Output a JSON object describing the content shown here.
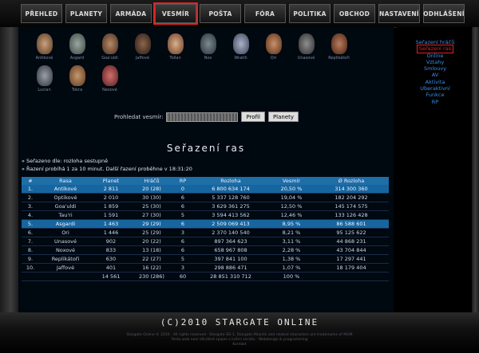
{
  "nav": {
    "tabs": [
      "PŘEHLED",
      "PLANETY",
      "ARMÁDA",
      "VESMÍR",
      "POŠTA",
      "FÓRA",
      "POLITIKA",
      "OBCHOD",
      "NASTAVENÍ",
      "ODHLÁŠENÍ"
    ],
    "active": "VESMÍR"
  },
  "avatars": [
    "Antikové",
    "Asgard",
    "Goa'uldi",
    "Jaffové",
    "Tollan",
    "Nox",
    "Wraith",
    "Ori",
    "Unasové",
    "Replikátoři",
    "Lucian",
    "Tokra",
    "Nexové"
  ],
  "search": {
    "label": "Prohledat vesmír:",
    "profile_button": "Profil",
    "planets_button": "Planety"
  },
  "page_title": "Seřazení ras",
  "sort_info": "» Seřazeno dle: rozloha sestupně",
  "update_info": "» Řazení probíhá 1 za 10 minut. Další řazení proběhne v 18:31:20",
  "table": {
    "headers": [
      "#",
      "Rasa",
      "Planet",
      "Hráčů",
      "RP",
      "Rozloha",
      "Vesmír",
      "Ø Rozloha"
    ],
    "rows": [
      [
        "1.",
        "Antikové",
        "2 811",
        "20 (28)",
        "0",
        "6 800 634 174",
        "20,50 %",
        "314 300 360"
      ],
      [
        "2.",
        "Optikové",
        "2 010",
        "30 (30)",
        "6",
        "5 337 128 760",
        "19,04 %",
        "182 204 292"
      ],
      [
        "3.",
        "Goa'uldi",
        "1 859",
        "25 (30)",
        "6",
        "3 629 361 275",
        "12,50 %",
        "145 174 575"
      ],
      [
        "4.",
        "Tau'ri",
        "1 591",
        "27 (30)",
        "5",
        "3 594 413 562",
        "12,46 %",
        "133 126 428"
      ],
      [
        "5.",
        "Asgardi",
        "1 463",
        "29 (29)",
        "6",
        "2 509 069 413",
        "8,95 %",
        "86 588 601"
      ],
      [
        "6.",
        "Ori",
        "1 446",
        "25 (29)",
        "3",
        "2 370 140 540",
        "8,21 %",
        "95 125 622"
      ],
      [
        "7.",
        "Unasové",
        "902",
        "20 (22)",
        "6",
        "897 364 623",
        "3,11 %",
        "44 868 231"
      ],
      [
        "8.",
        "Noxové",
        "833",
        "13 (18)",
        "6",
        "658 967 808",
        "2,28 %",
        "43 704 844"
      ],
      [
        "9.",
        "Replikátoři",
        "630",
        "22 (27)",
        "5",
        "397 841 100",
        "1,38 %",
        "17 297 441"
      ],
      [
        "10.",
        "Jaffové",
        "401",
        "16 (22)",
        "3",
        "298 886 471",
        "1,07 %",
        "18 179 404"
      ]
    ],
    "total": [
      "",
      "",
      "14 561",
      "230 (286)",
      "60",
      "28 851 310 712",
      "100 %",
      ""
    ]
  },
  "side_menu": [
    "Seřazení hráčů",
    "Seřazení ras",
    "Online",
    "Vztahy",
    "Smlouvy",
    "AV",
    "Aktivita",
    "Uberaktivní",
    "Funkce",
    "RP"
  ],
  "side_menu_active": "Seřazení ras",
  "footer": {
    "title": "(C)2010 STARGATE ONLINE",
    "small1": "Stargate Online © 2010 · All rights reserved · Stargate SG-1, Stargate Atlantis and related characters are trademarks of MGM",
    "small2": "Tento web není oficiálně spojen s tvůrci seriálu · Webdesign & programming",
    "small3": "Kontakt"
  }
}
